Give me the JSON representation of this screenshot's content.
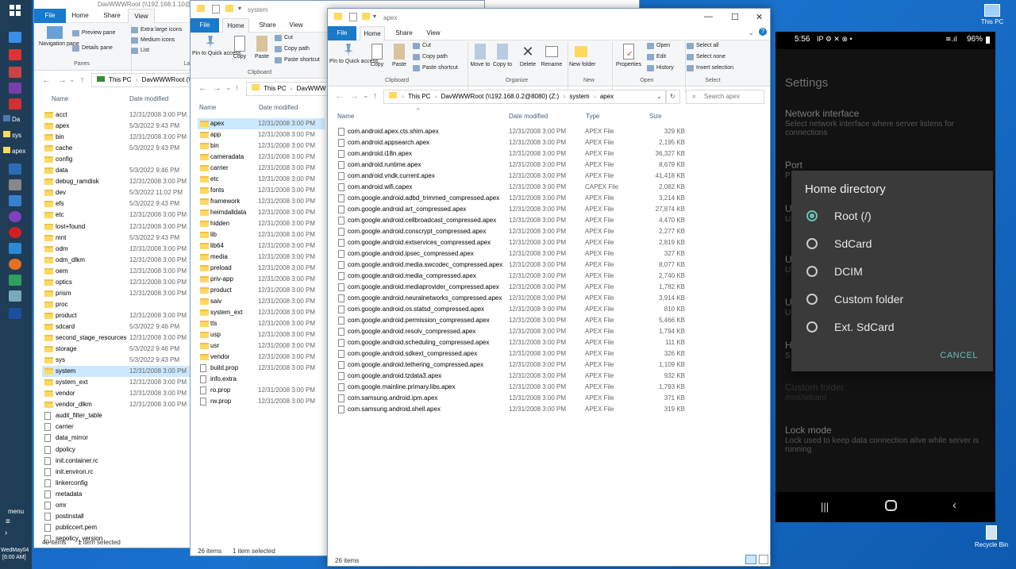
{
  "taskbar": {
    "items": [
      "Da",
      "sys",
      "apex"
    ],
    "menu_label": "menu",
    "clock_day": "WedMay04",
    "clock_time": "[6:00 AM]"
  },
  "desktop": {
    "this_pc_label": "This PC",
    "recycle_label": "Recycle Bin"
  },
  "win1": {
    "title": "DavWWWRoot (\\\\192.168.1.10@808",
    "tabs": [
      "File",
      "Home",
      "Share",
      "View"
    ],
    "ribbon": {
      "nav_pane": "Navigation pane",
      "preview_pane": "Preview pane",
      "details_pane": "Details pane",
      "panes_group": "Panes",
      "extra_large": "Extra large icons",
      "medium_icons": "Medium icons",
      "list": "List",
      "layout_group": "Lay"
    },
    "address": [
      "This PC",
      "DavWWWRoot (\\\\192.168.1.10@80"
    ],
    "col_name": "Name",
    "col_date": "Date modified",
    "rows": [
      {
        "n": "acct",
        "d": "12/31/2008 3:00 PM",
        "k": "folder"
      },
      {
        "n": "apex",
        "d": "5/3/2022 9:43 PM",
        "k": "folder"
      },
      {
        "n": "bin",
        "d": "12/31/2008 3:00 PM",
        "k": "folder"
      },
      {
        "n": "cache",
        "d": "5/3/2022 9:43 PM",
        "k": "folder"
      },
      {
        "n": "config",
        "d": "",
        "k": "folder"
      },
      {
        "n": "data",
        "d": "5/3/2022 9:46 PM",
        "k": "folder"
      },
      {
        "n": "debug_ramdisk",
        "d": "12/31/2008 3:00 PM",
        "k": "folder"
      },
      {
        "n": "dev",
        "d": "5/3/2022 11:02 PM",
        "k": "folder"
      },
      {
        "n": "efs",
        "d": "5/3/2022 9:43 PM",
        "k": "folder"
      },
      {
        "n": "etc",
        "d": "12/31/2008 3:00 PM",
        "k": "folder"
      },
      {
        "n": "lost+found",
        "d": "12/31/2008 3:00 PM",
        "k": "folder"
      },
      {
        "n": "mnt",
        "d": "5/3/2022 9:43 PM",
        "k": "folder"
      },
      {
        "n": "odm",
        "d": "12/31/2008 3:00 PM",
        "k": "folder"
      },
      {
        "n": "odm_dlkm",
        "d": "12/31/2008 3:00 PM",
        "k": "folder"
      },
      {
        "n": "oem",
        "d": "12/31/2008 3:00 PM",
        "k": "folder"
      },
      {
        "n": "optics",
        "d": "12/31/2008 3:00 PM",
        "k": "folder"
      },
      {
        "n": "prism",
        "d": "12/31/2008 3:00 PM",
        "k": "folder"
      },
      {
        "n": "proc",
        "d": "",
        "k": "folder"
      },
      {
        "n": "product",
        "d": "12/31/2008 3:00 PM",
        "k": "folder"
      },
      {
        "n": "sdcard",
        "d": "5/3/2022 9:46 PM",
        "k": "folder"
      },
      {
        "n": "second_stage_resources",
        "d": "12/31/2008 3:00 PM",
        "k": "folder"
      },
      {
        "n": "storage",
        "d": "5/3/2022 9:46 PM",
        "k": "folder"
      },
      {
        "n": "sys",
        "d": "5/3/2022 9:43 PM",
        "k": "folder"
      },
      {
        "n": "system",
        "d": "12/31/2008 3:00 PM",
        "k": "folder",
        "sel": true
      },
      {
        "n": "system_ext",
        "d": "12/31/2008 3:00 PM",
        "k": "folder"
      },
      {
        "n": "vendor",
        "d": "12/31/2008 3:00 PM",
        "k": "folder"
      },
      {
        "n": "vendor_dlkm",
        "d": "12/31/2008 3:00 PM",
        "k": "folder"
      },
      {
        "n": "audit_filter_table",
        "d": "",
        "k": "file"
      },
      {
        "n": "carrier",
        "d": "",
        "k": "file"
      },
      {
        "n": "data_mirror",
        "d": "",
        "k": "file"
      },
      {
        "n": "dpolicy",
        "d": "",
        "k": "file"
      },
      {
        "n": "init.container.rc",
        "d": "",
        "k": "file"
      },
      {
        "n": "init.environ.rc",
        "d": "",
        "k": "file"
      },
      {
        "n": "linkerconfig",
        "d": "",
        "k": "file"
      },
      {
        "n": "metadata",
        "d": "",
        "k": "file"
      },
      {
        "n": "omr",
        "d": "",
        "k": "file"
      },
      {
        "n": "postinstall",
        "d": "",
        "k": "file"
      },
      {
        "n": "publiccert.pem",
        "d": "",
        "k": "file"
      },
      {
        "n": "sepolicy_version",
        "d": "",
        "k": "file"
      }
    ],
    "status_count": "40 items",
    "status_sel": "1 item selected"
  },
  "win2": {
    "title": "system",
    "tabs": [
      "File",
      "Home",
      "Share",
      "View"
    ],
    "ribbon": {
      "pin": "Pin to Quick access",
      "copy": "Copy",
      "paste": "Paste",
      "cut": "Cut",
      "copy_path": "Copy path",
      "paste_shortcut": "Paste shortcut",
      "clipboard": "Clipboard"
    },
    "address": [
      "This PC",
      "DavWWW"
    ],
    "col_name": "Name",
    "col_date": "Date modified",
    "rows": [
      {
        "n": "apex",
        "d": "12/31/2008 3:00 PM",
        "k": "folder",
        "sel": true
      },
      {
        "n": "app",
        "d": "12/31/2008 3:00 PM",
        "k": "folder"
      },
      {
        "n": "bin",
        "d": "12/31/2008 3:00 PM",
        "k": "folder"
      },
      {
        "n": "cameradata",
        "d": "12/31/2008 3:00 PM",
        "k": "folder"
      },
      {
        "n": "carrier",
        "d": "12/31/2008 3:00 PM",
        "k": "folder"
      },
      {
        "n": "etc",
        "d": "12/31/2008 3:00 PM",
        "k": "folder"
      },
      {
        "n": "fonts",
        "d": "12/31/2008 3:00 PM",
        "k": "folder"
      },
      {
        "n": "framework",
        "d": "12/31/2008 3:00 PM",
        "k": "folder"
      },
      {
        "n": "heimdalldata",
        "d": "12/31/2008 3:00 PM",
        "k": "folder"
      },
      {
        "n": "hidden",
        "d": "12/31/2008 3:00 PM",
        "k": "folder"
      },
      {
        "n": "lib",
        "d": "12/31/2008 3:00 PM",
        "k": "folder"
      },
      {
        "n": "lib64",
        "d": "12/31/2008 3:00 PM",
        "k": "folder"
      },
      {
        "n": "media",
        "d": "12/31/2008 3:00 PM",
        "k": "folder"
      },
      {
        "n": "preload",
        "d": "12/31/2008 3:00 PM",
        "k": "folder"
      },
      {
        "n": "priv-app",
        "d": "12/31/2008 3:00 PM",
        "k": "folder"
      },
      {
        "n": "product",
        "d": "12/31/2008 3:00 PM",
        "k": "folder"
      },
      {
        "n": "saiv",
        "d": "12/31/2008 3:00 PM",
        "k": "folder"
      },
      {
        "n": "system_ext",
        "d": "12/31/2008 3:00 PM",
        "k": "folder"
      },
      {
        "n": "tts",
        "d": "12/31/2008 3:00 PM",
        "k": "folder"
      },
      {
        "n": "usp",
        "d": "12/31/2008 3:00 PM",
        "k": "folder"
      },
      {
        "n": "usr",
        "d": "12/31/2008 3:00 PM",
        "k": "folder"
      },
      {
        "n": "vendor",
        "d": "12/31/2008 3:00 PM",
        "k": "folder"
      },
      {
        "n": "build.prop",
        "d": "12/31/2008 3:00 PM",
        "k": "file"
      },
      {
        "n": "info.extra",
        "d": "",
        "k": "file"
      },
      {
        "n": "ro.prop",
        "d": "12/31/2008 3:00 PM",
        "k": "file"
      },
      {
        "n": "rw.prop",
        "d": "12/31/2008 3:00 PM",
        "k": "file"
      }
    ],
    "status_count": "26 items",
    "status_sel": "1 item selected"
  },
  "win3": {
    "title": "apex",
    "tabs": [
      "File",
      "Home",
      "Share",
      "View"
    ],
    "ribbon": {
      "pin": "Pin to Quick access",
      "copy": "Copy",
      "paste": "Paste",
      "cut": "Cut",
      "copy_path": "Copy path",
      "paste_shortcut": "Paste shortcut",
      "clipboard": "Clipboard",
      "move_to": "Move to",
      "copy_to": "Copy to",
      "delete": "Delete",
      "rename": "Rename",
      "organize": "Organize",
      "new_folder": "New folder",
      "new": "New",
      "properties": "Properties",
      "open": "Open",
      "edit": "Edit",
      "history": "History",
      "open_group": "Open",
      "select_all": "Select all",
      "select_none": "Select none",
      "invert": "Invert selection",
      "select": "Select"
    },
    "address": [
      "This PC",
      "DavWWWRoot (\\\\192.168.0.2@8080) (Z:)",
      "system",
      "apex"
    ],
    "search_placeholder": "Search apex",
    "cols": {
      "name": "Name",
      "date": "Date modified",
      "type": "Type",
      "size": "Size"
    },
    "rows": [
      {
        "n": "com.android.apex.cts.shim.apex",
        "d": "12/31/2008 3:00 PM",
        "t": "APEX File",
        "s": "329 KB"
      },
      {
        "n": "com.android.appsearch.apex",
        "d": "12/31/2008 3:00 PM",
        "t": "APEX File",
        "s": "2,195 KB"
      },
      {
        "n": "com.android.i18n.apex",
        "d": "12/31/2008 3:00 PM",
        "t": "APEX File",
        "s": "36,327 KB"
      },
      {
        "n": "com.android.runtime.apex",
        "d": "12/31/2008 3:00 PM",
        "t": "APEX File",
        "s": "8,679 KB"
      },
      {
        "n": "com.android.vndk.current.apex",
        "d": "12/31/2008 3:00 PM",
        "t": "APEX File",
        "s": "41,418 KB"
      },
      {
        "n": "com.android.wifi.capex",
        "d": "12/31/2008 3:00 PM",
        "t": "CAPEX File",
        "s": "2,082 KB"
      },
      {
        "n": "com.google.android.adbd_trimmed_compressed.apex",
        "d": "12/31/2008 3:00 PM",
        "t": "APEX File",
        "s": "3,214 KB"
      },
      {
        "n": "com.google.android.art_compressed.apex",
        "d": "12/31/2008 3:00 PM",
        "t": "APEX File",
        "s": "27,874 KB"
      },
      {
        "n": "com.google.android.cellbroadcast_compressed.apex",
        "d": "12/31/2008 3:00 PM",
        "t": "APEX File",
        "s": "4,470 KB"
      },
      {
        "n": "com.google.android.conscrypt_compressed.apex",
        "d": "12/31/2008 3:00 PM",
        "t": "APEX File",
        "s": "2,277 KB"
      },
      {
        "n": "com.google.android.extservices_compressed.apex",
        "d": "12/31/2008 3:00 PM",
        "t": "APEX File",
        "s": "2,819 KB"
      },
      {
        "n": "com.google.android.ipsec_compressed.apex",
        "d": "12/31/2008 3:00 PM",
        "t": "APEX File",
        "s": "327 KB"
      },
      {
        "n": "com.google.android.media.swcodec_compressed.apex",
        "d": "12/31/2008 3:00 PM",
        "t": "APEX File",
        "s": "8,077 KB"
      },
      {
        "n": "com.google.android.media_compressed.apex",
        "d": "12/31/2008 3:00 PM",
        "t": "APEX File",
        "s": "2,740 KB"
      },
      {
        "n": "com.google.android.mediaprovider_compressed.apex",
        "d": "12/31/2008 3:00 PM",
        "t": "APEX File",
        "s": "1,782 KB"
      },
      {
        "n": "com.google.android.neuralnetworks_compressed.apex",
        "d": "12/31/2008 3:00 PM",
        "t": "APEX File",
        "s": "3,914 KB"
      },
      {
        "n": "com.google.android.os.statsd_compressed.apex",
        "d": "12/31/2008 3:00 PM",
        "t": "APEX File",
        "s": "810 KB"
      },
      {
        "n": "com.google.android.permission_compressed.apex",
        "d": "12/31/2008 3:00 PM",
        "t": "APEX File",
        "s": "5,466 KB"
      },
      {
        "n": "com.google.android.resolv_compressed.apex",
        "d": "12/31/2008 3:00 PM",
        "t": "APEX File",
        "s": "1,794 KB"
      },
      {
        "n": "com.google.android.scheduling_compressed.apex",
        "d": "12/31/2008 3:00 PM",
        "t": "APEX File",
        "s": "111 KB"
      },
      {
        "n": "com.google.android.sdkext_compressed.apex",
        "d": "12/31/2008 3:00 PM",
        "t": "APEX File",
        "s": "326 KB"
      },
      {
        "n": "com.google.android.tethering_compressed.apex",
        "d": "12/31/2008 3:00 PM",
        "t": "APEX File",
        "s": "1,109 KB"
      },
      {
        "n": "com.google.android.tzdata3.apex",
        "d": "12/31/2008 3:00 PM",
        "t": "APEX File",
        "s": "932 KB"
      },
      {
        "n": "com.google.mainline.primary.libs.apex",
        "d": "12/31/2008 3:00 PM",
        "t": "APEX File",
        "s": "1,793 KB"
      },
      {
        "n": "com.samsung.android.ipm.apex",
        "d": "12/31/2008 3:00 PM",
        "t": "APEX File",
        "s": "371 KB"
      },
      {
        "n": "com.samsung.android.shell.apex",
        "d": "12/31/2008 3:00 PM",
        "t": "APEX File",
        "s": "319 KB"
      }
    ],
    "status_count": "26 items"
  },
  "phone": {
    "time": "5:56",
    "status_icons": "IP ⚙ ✕ ⊗ •",
    "status_right": "96%",
    "settings_title": "Settings",
    "items": [
      {
        "h": "Network interface",
        "s": "Select network interface where server listens for connections"
      },
      {
        "h": "Port",
        "s": "P"
      },
      {
        "h": "U",
        "s": "U"
      },
      {
        "h": "U",
        "s": "U"
      },
      {
        "h": "U",
        "s": "U"
      },
      {
        "h": "H",
        "s": "S"
      },
      {
        "h": "Custom folder",
        "s": "/mnt/sdcard"
      },
      {
        "h": "Lock mode",
        "s": "Lock used to keep data connection alive while server is running"
      }
    ],
    "dialog": {
      "title": "Home directory",
      "options": [
        "Root (/)",
        "SdCard",
        "DCIM",
        "Custom folder",
        "Ext. SdCard"
      ],
      "selected_index": 0,
      "cancel": "CANCEL"
    }
  }
}
